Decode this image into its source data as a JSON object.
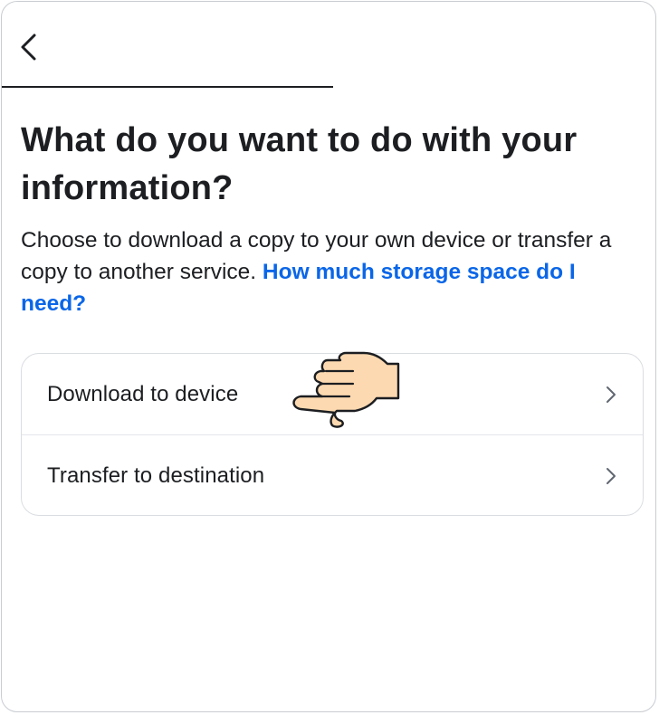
{
  "header": {
    "back_icon": "chevron-left-icon"
  },
  "content": {
    "title": "What do you want to do with your information?",
    "description": "Choose to download a copy to your own device or transfer a copy to another service.",
    "help_link": "How much storage space do I need?"
  },
  "options": [
    {
      "label": "Download to device",
      "icon": "chevron-right-icon"
    },
    {
      "label": "Transfer to destination",
      "icon": "chevron-right-icon"
    }
  ],
  "overlay": {
    "icon": "pointing-hand-icon"
  },
  "colors": {
    "text": "#1c1e21",
    "link": "#0a66e8",
    "border": "#dadde1",
    "hand_fill": "#fcd9b0"
  }
}
